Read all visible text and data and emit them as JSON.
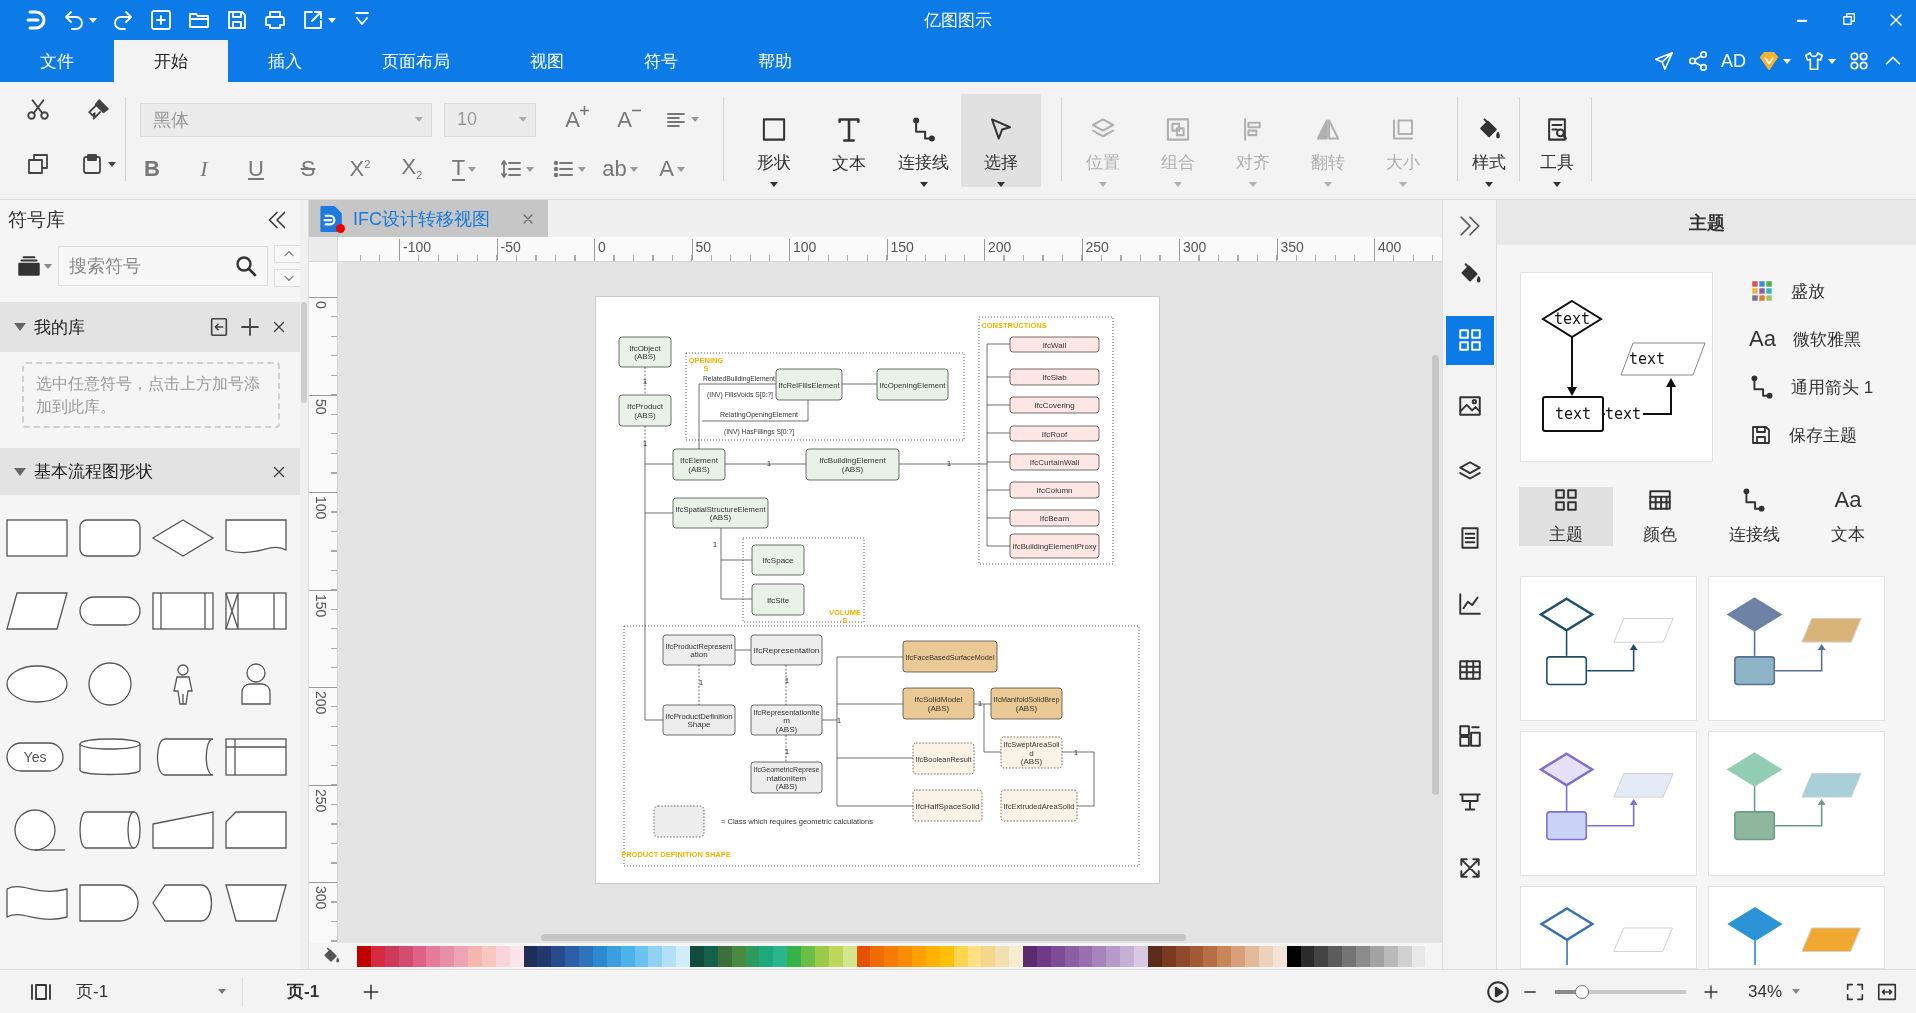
{
  "window": {
    "title": "亿图图示"
  },
  "menu_tabs": [
    {
      "label": "文件",
      "selected": false
    },
    {
      "label": "开始",
      "selected": true
    },
    {
      "label": "插入",
      "selected": false
    },
    {
      "label": "页面布局",
      "selected": false
    },
    {
      "label": "视图",
      "selected": false
    },
    {
      "label": "符号",
      "selected": false
    },
    {
      "label": "帮助",
      "selected": false
    }
  ],
  "account": {
    "initials": "AD"
  },
  "ribbon": {
    "font": "黑体",
    "font_size": "10",
    "text_tools": [
      {
        "kind": "grow",
        "label": "A"
      },
      {
        "kind": "shrink",
        "label": "A"
      }
    ],
    "format_tools": [
      {
        "kind": "bold",
        "label": "B"
      },
      {
        "kind": "italic",
        "label": "I"
      },
      {
        "kind": "underline",
        "label": "U"
      },
      {
        "kind": "strike",
        "label": "S"
      },
      {
        "kind": "superscript",
        "label": "X$^{2}$"
      },
      {
        "kind": "subscript",
        "label": "X$_{2}$"
      },
      {
        "kind": "textcolor",
        "label": "T"
      },
      {
        "kind": "spacing"
      },
      {
        "kind": "list"
      },
      {
        "kind": "highlight",
        "label": "ab"
      },
      {
        "kind": "fontcolor",
        "label": "A"
      }
    ],
    "tools": [
      {
        "label": "形状",
        "dropdown": true,
        "disabled": false,
        "selected": false
      },
      {
        "label": "文本",
        "dropdown": false,
        "disabled": false,
        "selected": false
      },
      {
        "label": "连接线",
        "dropdown": true,
        "disabled": false,
        "selected": false
      },
      {
        "label": "选择",
        "dropdown": true,
        "disabled": false,
        "selected": true
      },
      {
        "label": "位置",
        "dropdown": true,
        "disabled": true,
        "selected": false
      },
      {
        "label": "组合",
        "dropdown": true,
        "disabled": true,
        "selected": false
      },
      {
        "label": "对齐",
        "dropdown": true,
        "disabled": true,
        "selected": false
      },
      {
        "label": "翻转",
        "dropdown": true,
        "disabled": true,
        "selected": false
      },
      {
        "label": "大小",
        "dropdown": true,
        "disabled": true,
        "selected": false
      },
      {
        "label": "样式",
        "dropdown": true,
        "disabled": false,
        "selected": false
      },
      {
        "label": "工具",
        "dropdown": true,
        "disabled": false,
        "selected": false
      }
    ]
  },
  "symbols": {
    "title": "符号库",
    "search": {
      "placeholder": "搜索符号"
    },
    "sections": [
      {
        "title": "我的库",
        "expanded": true,
        "hint": "选中任意符号，点击上方加号添加到此库。"
      },
      {
        "title": "基本流程图形状",
        "expanded": true,
        "shapes": [
          {
            "kind": "rectangle"
          },
          {
            "kind": "rounded"
          },
          {
            "kind": "diamond"
          },
          {
            "kind": "document"
          },
          {
            "kind": "parallelogram"
          },
          {
            "kind": "terminator"
          },
          {
            "kind": "predefined"
          },
          {
            "kind": "collate"
          },
          {
            "kind": "ellipse"
          },
          {
            "kind": "circle"
          },
          {
            "kind": "actor"
          },
          {
            "kind": "person"
          },
          {
            "kind": "pill",
            "text": "Yes"
          },
          {
            "kind": "cylinder"
          },
          {
            "kind": "stored"
          },
          {
            "kind": "storage"
          },
          {
            "kind": "sequential"
          },
          {
            "kind": "drum"
          },
          {
            "kind": "manual-input"
          },
          {
            "kind": "card"
          },
          {
            "kind": "tape"
          },
          {
            "kind": "delay"
          },
          {
            "kind": "display"
          },
          {
            "kind": "manual-operation"
          }
        ]
      }
    ]
  },
  "document_tab": {
    "title": "IFC设计转移视图",
    "unsaved": true
  },
  "rulers": {
    "horizontal": [
      "-100",
      "-50",
      "0",
      "50",
      "100",
      "150",
      "200",
      "250",
      "300",
      "350",
      "400"
    ],
    "vertical": [
      "0",
      "50",
      "100",
      "150",
      "200",
      "250",
      "300"
    ]
  },
  "diagram": {
    "groups": [
      {
        "label": [
          "OPENING",
          "S"
        ]
      },
      {
        "label": [
          "CONSTRUCTIONS"
        ]
      },
      {
        "label": [
          "VOLUME",
          "S"
        ]
      },
      {
        "label": [
          "PRODUCT DEFINITION SHAPE"
        ]
      }
    ],
    "nodes": [
      {
        "lines": [
          "IfcObject",
          "(ABS)"
        ],
        "kind": "entity"
      },
      {
        "lines": [
          "IfcProduct",
          "(ABS)"
        ],
        "kind": "entity"
      },
      {
        "lines": [
          "IfcRelFillsElement"
        ],
        "kind": "entity"
      },
      {
        "lines": [
          "IfcOpeningElement"
        ],
        "kind": "entity"
      },
      {
        "lines": [
          "IfcElement",
          "(ABS)"
        ],
        "kind": "entity"
      },
      {
        "lines": [
          "IfcBuildingElement",
          "(ABS)"
        ],
        "kind": "entity"
      },
      {
        "lines": [
          "IfcSpatialStructureElement",
          "(ABS)"
        ],
        "kind": "entity"
      },
      {
        "lines": [
          "IfcSpace"
        ],
        "kind": "entity"
      },
      {
        "lines": [
          "IfcSite"
        ],
        "kind": "entity"
      },
      {
        "lines": [
          "IfcWall"
        ],
        "kind": "construction"
      },
      {
        "lines": [
          "IfcSlab"
        ],
        "kind": "construction"
      },
      {
        "lines": [
          "IfcCovering"
        ],
        "kind": "construction"
      },
      {
        "lines": [
          "IfcRoof"
        ],
        "kind": "construction"
      },
      {
        "lines": [
          "IfcCurtainWall"
        ],
        "kind": "construction"
      },
      {
        "lines": [
          "IfcColumn"
        ],
        "kind": "construction"
      },
      {
        "lines": [
          "IfcBeam"
        ],
        "kind": "construction"
      },
      {
        "lines": [
          "IfcBuildingElementProxy"
        ],
        "kind": "construction"
      },
      {
        "lines": [
          "IfcProductRepresent",
          "ation"
        ],
        "kind": "representation"
      },
      {
        "lines": [
          "IfcRepresentation"
        ],
        "kind": "representation"
      },
      {
        "lines": [
          "IfcProductDefinition",
          "Shape"
        ],
        "kind": "representation"
      },
      {
        "lines": [
          "IfcRepresentationIte",
          "m",
          "(ABS)"
        ],
        "kind": "representation"
      },
      {
        "lines": [
          "IfcGeometricReprese",
          "ntationItem",
          "(ABS)"
        ],
        "kind": "representation"
      },
      {
        "lines": [
          "IfcFaceBasedSurfaceModel"
        ],
        "kind": "geometry"
      },
      {
        "lines": [
          "IfcSolidModel",
          "(ABS)"
        ],
        "kind": "geometry"
      },
      {
        "lines": [
          "IfcManifoldSolidBrep",
          "(ABS)"
        ],
        "kind": "geometry"
      },
      {
        "lines": [
          "IfcBooleanResult"
        ],
        "kind": "calc"
      },
      {
        "lines": [
          "IfcSweptAreaSoli",
          "d",
          "(ABS)"
        ],
        "kind": "calc"
      },
      {
        "lines": [
          "IfcHalfSpaceSolid"
        ],
        "kind": "calc"
      },
      {
        "lines": [
          "IfcExtrudedAreaSolid"
        ],
        "kind": "calc"
      }
    ],
    "relation_labels": [
      "RelatedBuildingElement",
      "(INV) FillsVoids S[0:?]",
      "RelatingOpeningElement",
      "(INV) HasFillings S[0:?]"
    ],
    "multiplicities": [
      "1",
      "1",
      "1",
      "1",
      "1",
      "1",
      "1",
      "1",
      "1",
      "1",
      "1"
    ],
    "legend": {
      "kind": "calc",
      "text": "= Class which requires geometric calculations"
    }
  },
  "palette": [
    {
      "color": "#c00000"
    },
    {
      "color": "#d62a3f"
    },
    {
      "color": "#cf3a5a"
    },
    {
      "color": "#d24d6e"
    },
    {
      "color": "#e06086"
    },
    {
      "color": "#e57a9b"
    },
    {
      "color": "#e88fa8"
    },
    {
      "color": "#f0a3b5"
    },
    {
      "color": "#f5b6b0"
    },
    {
      "color": "#f8c8c0"
    },
    {
      "color": "#f8d5dc"
    },
    {
      "color": "#fbe5ea"
    },
    {
      "color": "#1f2d5a"
    },
    {
      "color": "#23396e"
    },
    {
      "color": "#274b8a"
    },
    {
      "color": "#2d5fa8"
    },
    {
      "color": "#2f73bd"
    },
    {
      "color": "#2e8ad0"
    },
    {
      "color": "#3a9ee0"
    },
    {
      "color": "#4bb2ea"
    },
    {
      "color": "#6cc3f0"
    },
    {
      "color": "#8fd2f4"
    },
    {
      "color": "#b3e0f7"
    },
    {
      "color": "#d2ecf9"
    },
    {
      "color": "#0f4d3a"
    },
    {
      "color": "#14624a"
    },
    {
      "color": "#3d6f3a"
    },
    {
      "color": "#4a8a3e"
    },
    {
      "color": "#2e9a5c"
    },
    {
      "color": "#1fa87a"
    },
    {
      "color": "#2bb58c"
    },
    {
      "color": "#36b24a"
    },
    {
      "color": "#6cbd45"
    },
    {
      "color": "#9bc94a"
    },
    {
      "color": "#bcd75a"
    },
    {
      "color": "#d4e58f"
    },
    {
      "color": "#e65100"
    },
    {
      "color": "#ef6c00"
    },
    {
      "color": "#f57c00"
    },
    {
      "color": "#fb8c00"
    },
    {
      "color": "#ffa000"
    },
    {
      "color": "#ffb300"
    },
    {
      "color": "#ffc107"
    },
    {
      "color": "#ffd54f"
    },
    {
      "color": "#ffe082"
    },
    {
      "color": "#f5d68f"
    },
    {
      "color": "#f3e0b0"
    },
    {
      "color": "#f8ecd0"
    },
    {
      "color": "#5c2a6e"
    },
    {
      "color": "#6f3a86"
    },
    {
      "color": "#7e4c96"
    },
    {
      "color": "#8c5ea3"
    },
    {
      "color": "#9a6fb0"
    },
    {
      "color": "#a884bc"
    },
    {
      "color": "#b79ac9"
    },
    {
      "color": "#c7b0d6"
    },
    {
      "color": "#d8c8e3"
    },
    {
      "color": "#5b2c1a"
    },
    {
      "color": "#7a3a20"
    },
    {
      "color": "#8e4a2a"
    },
    {
      "color": "#a35a35"
    },
    {
      "color": "#b86e45"
    },
    {
      "color": "#c98658"
    },
    {
      "color": "#d7a07a"
    },
    {
      "color": "#e3bb9c"
    },
    {
      "color": "#ecd1bc"
    },
    {
      "color": "#f3e3d6"
    },
    {
      "color": "#000000"
    },
    {
      "color": "#2b2b2b"
    },
    {
      "color": "#444444"
    },
    {
      "color": "#5c5c5c"
    },
    {
      "color": "#747474"
    },
    {
      "color": "#8c8c8c"
    },
    {
      "color": "#a3a3a3"
    },
    {
      "color": "#bababa"
    },
    {
      "color": "#d1d1d1"
    },
    {
      "color": "#e8e8e8"
    }
  ],
  "side_tools": [
    {
      "selected": false
    },
    {
      "selected": true
    },
    {
      "selected": false
    },
    {
      "selected": false
    },
    {
      "selected": false
    },
    {
      "selected": false
    },
    {
      "selected": false
    },
    {
      "selected": false
    },
    {
      "selected": false
    },
    {
      "selected": false
    }
  ],
  "theme_panel": {
    "title": "主题",
    "preview_labels": [
      "text",
      "text",
      "text",
      "text"
    ],
    "options": [
      {
        "kind": "theme",
        "label": "盛放"
      },
      {
        "kind": "font",
        "glyph": "Aa",
        "label": "微软雅黑"
      },
      {
        "kind": "connector",
        "label": "通用箭头 1"
      },
      {
        "kind": "save",
        "label": "保存主题"
      }
    ],
    "tabs": [
      {
        "kind": "theme",
        "label": "主题",
        "selected": true
      },
      {
        "kind": "color",
        "label": "颜色",
        "selected": false
      },
      {
        "kind": "connector",
        "label": "连接线",
        "selected": false
      },
      {
        "kind": "text",
        "glyph": "Aa",
        "label": "文本",
        "selected": false
      }
    ],
    "themes": [
      {
        "color": "#1f4e6b"
      },
      {
        "color": "#6e82a6"
      },
      {
        "color": "#7d6fd1"
      },
      {
        "color": "#93cdb4"
      },
      {
        "color": "#3a6fb0"
      },
      {
        "color": "#2b93d6"
      }
    ]
  },
  "status_bar": {
    "page_select": "页-1",
    "pages": [
      {
        "label": "页-1",
        "selected": true
      }
    ],
    "zoom": {
      "level": 0.17,
      "reading": "34%"
    }
  }
}
